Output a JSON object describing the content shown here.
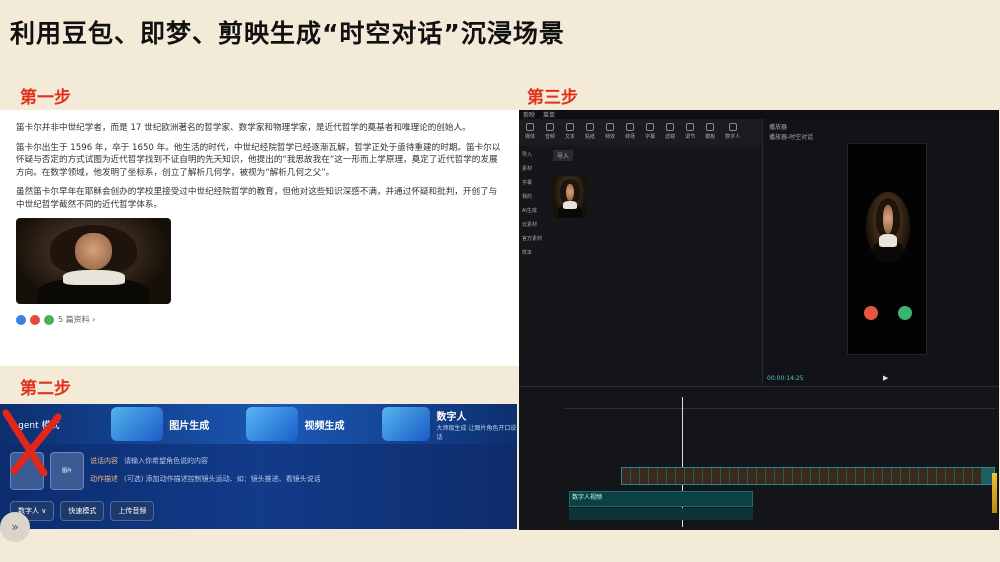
{
  "slide": {
    "title": "利用豆包、即梦、剪映生成“时空对话”沉浸场景",
    "step1": "第一步",
    "step2": "第二步",
    "step3": "第三步"
  },
  "doubao": {
    "para1": "笛卡尔并非中世纪学者，而是 17 世纪欧洲著名的哲学家、数学家和物理学家，是近代哲学的奠基者和唯理论的创始人。",
    "para2": "笛卡尔出生于 1596 年，卒于 1650 年。他生活的时代，中世纪经院哲学已经逐渐瓦解，哲学正处于亟待重建的时期。笛卡尔以怀疑与否定的方式试图为近代哲学找到不证自明的先天知识，他提出的“我思故我在”这一形而上学原理，奠定了近代哲学的发展方向。在数学领域，他发明了坐标系，创立了解析几何学，被视为“解析几何之父”。",
    "para3": "虽然笛卡尔早年在耶稣会创办的学校里接受过中世纪经院哲学的教育，但他对这些知识深感不满，并通过怀疑和批判，开创了与中世纪哲学截然不同的近代哲学体系。",
    "sources": "5 篇资料 ›"
  },
  "jimeng": {
    "agent": "Agent 模式",
    "tab_image": "图片生成",
    "tab_video": "视频生成",
    "tab_digital": "数字人",
    "tab_digital_sub": "大师级生成 让图片角色开口说话",
    "field1_label": "说话内容",
    "field1_placeholder": "请输入你希望角色说的内容",
    "field2_label": "动作描述",
    "field2_placeholder": "(可选) 添加动作描述控制镜头运动、如：镜头推进、看镜头说话",
    "btn_mode": "数字人 ∨",
    "btn_fast": "快速模式",
    "btn_upload": "上传音频",
    "thumb_label": "图片"
  },
  "jianying": {
    "menu": [
      "剪映",
      "菜单"
    ],
    "tools": [
      "媒体",
      "音频",
      "文本",
      "贴纸",
      "特效",
      "转场",
      "字幕",
      "滤镜",
      "调节",
      "模板",
      "数字人"
    ],
    "sidebar": [
      "导入",
      "素材",
      "字幕",
      "我的",
      "AI生成",
      "云素材",
      "官方素材",
      "样本"
    ],
    "import_label": "导入",
    "player_title": "播放器",
    "player_sub": "播放器-时空对话",
    "timecode": "00:00:14:25",
    "clip_label": "数字人视频"
  },
  "colors": {
    "accent_red": "#e1311a",
    "decline": "#e9543e",
    "accept": "#3cb371"
  }
}
